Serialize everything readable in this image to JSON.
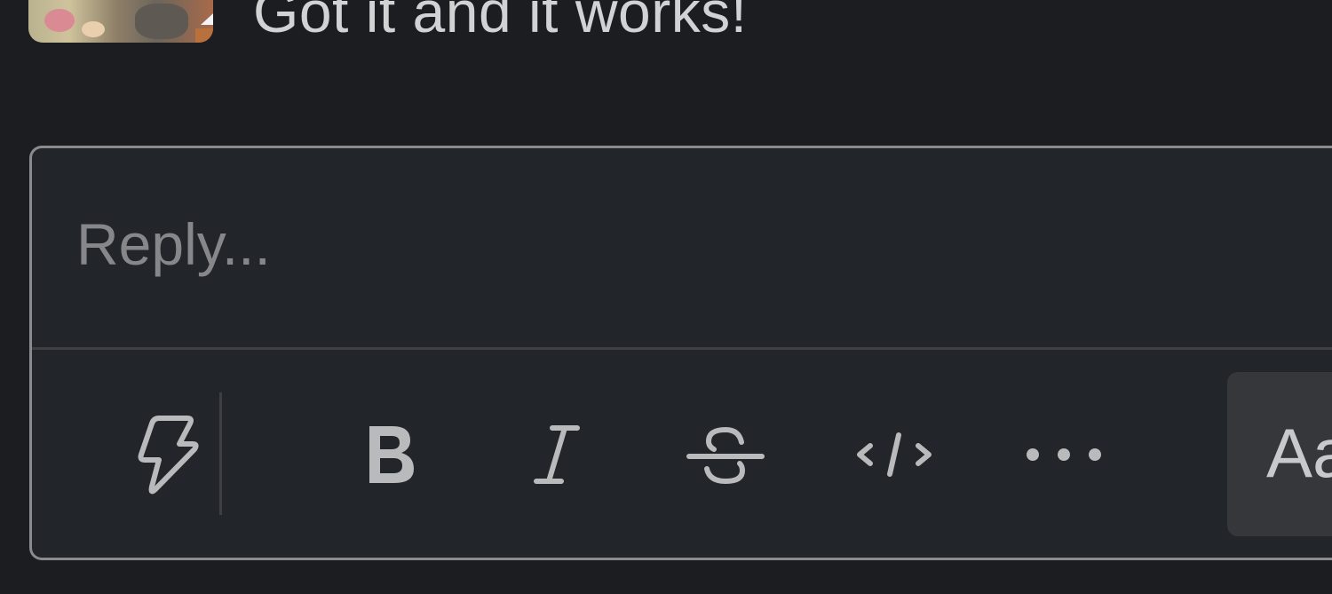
{
  "message": {
    "text": "Got it and it works!"
  },
  "composer": {
    "placeholder": "Reply...",
    "toolbar": {
      "shortcuts_icon": "lightning-bolt-icon",
      "bold_icon": "bold-icon",
      "italic_icon": "italic-icon",
      "strikethrough_icon": "strikethrough-icon",
      "code_icon": "code-icon",
      "more_icon": "more-formatting-icon",
      "format_toggle_label": "Aa"
    }
  },
  "colors": {
    "background": "#1b1d21",
    "composer_bg": "#222529",
    "composer_border": "#8a8b8e",
    "icon": "#b9babc",
    "placeholder": "#86878a"
  }
}
